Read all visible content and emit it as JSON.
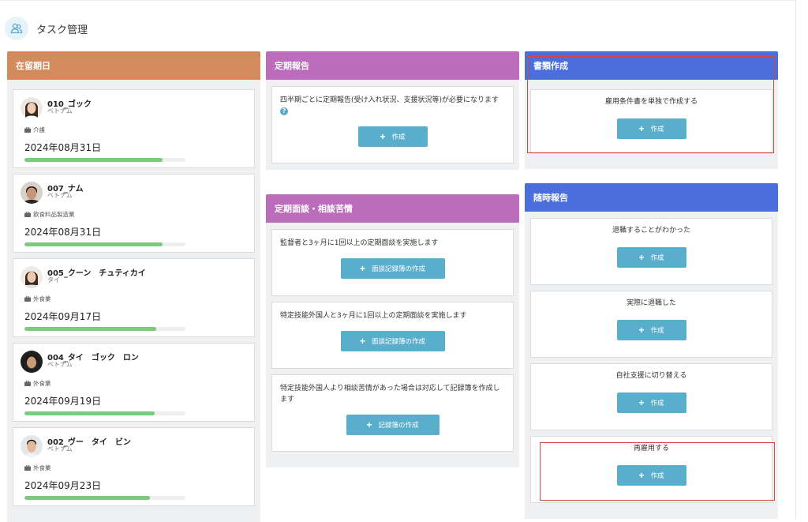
{
  "header": {
    "title": "タスク管理",
    "icon": "users-icon"
  },
  "colors": {
    "residence": "#d38b5d",
    "regular_report": "#bb6cbb",
    "interview": "#bb6cbb",
    "documents": "#4a6fdc",
    "adhoc": "#4a6fdc",
    "button": "#59aecb",
    "progress": "#7ccb7c"
  },
  "residence": {
    "title": "在留期日",
    "people": [
      {
        "name": "010_ゴック",
        "nationality": "ベトナム",
        "industry": "介護",
        "date": "2024年08月31日",
        "progress": 0.86
      },
      {
        "name": "007_ナム",
        "nationality": "ベトナム",
        "industry": "飲食料品製造業",
        "date": "2024年08月31日",
        "progress": 0.86
      },
      {
        "name": "005_クーン　チュティカイ",
        "nationality": "タイ",
        "industry": "外食業",
        "date": "2024年09月17日",
        "progress": 0.82
      },
      {
        "name": "004_タイ　ゴック　ロン",
        "nationality": "ベトナム",
        "industry": "外食業",
        "date": "2024年09月19日",
        "progress": 0.81
      },
      {
        "name": "002_ヴー　タイ　ビン",
        "nationality": "ベトナム",
        "industry": "外食業",
        "date": "2024年09月23日",
        "progress": 0.78
      }
    ]
  },
  "regular_report": {
    "title": "定期報告",
    "text": "四半期ごとに定期報告(受け入れ状況、支援状況等)が必要になります",
    "button": "作成"
  },
  "interview": {
    "title": "定期面談・相談苦情",
    "tasks": [
      {
        "text": "監督者と3ヶ月に1回以上の定期面談を実施します",
        "button": "面談記録簿の作成"
      },
      {
        "text": "特定技能外国人と3ヶ月に1回以上の定期面談を実施します",
        "button": "面談記録簿の作成"
      },
      {
        "text": "特定技能外国人より相談苦情があった場合は対応して記録簿を作成します",
        "button": "記録簿の作成"
      }
    ]
  },
  "documents": {
    "title": "書類作成",
    "text": "雇用条件書を単独で作成する",
    "button": "作成"
  },
  "adhoc": {
    "title": "随時報告",
    "tasks": [
      {
        "text": "退職することがわかった",
        "button": "作成"
      },
      {
        "text": "実際に退職した",
        "button": "作成"
      },
      {
        "text": "自社支援に切り替える",
        "button": "作成"
      },
      {
        "text": "再雇用する",
        "button": "作成"
      }
    ]
  }
}
